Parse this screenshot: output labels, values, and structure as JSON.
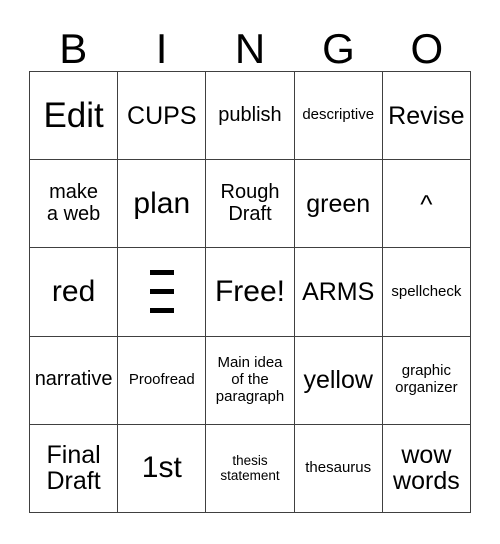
{
  "card": {
    "title": "BINGO",
    "header": {
      "letters": [
        "B",
        "I",
        "N",
        "G",
        "O"
      ]
    },
    "grid": {
      "rows": 5,
      "columns": 5,
      "border_color": "#404040",
      "background_color": "#ffffff",
      "text_color": "#000000"
    },
    "cells": [
      {
        "row": 1,
        "col": 1,
        "column_letter": "B",
        "text": "Edit",
        "size": "fs-xl",
        "glyph": "none"
      },
      {
        "row": 1,
        "col": 2,
        "column_letter": "I",
        "text": "CUPS",
        "size": "fs-md",
        "glyph": "none"
      },
      {
        "row": 1,
        "col": 3,
        "column_letter": "N",
        "text": "publish",
        "size": "fs-sm",
        "glyph": "none"
      },
      {
        "row": 1,
        "col": 4,
        "column_letter": "G",
        "text": "descriptive",
        "size": "fs-xs",
        "glyph": "none"
      },
      {
        "row": 1,
        "col": 5,
        "column_letter": "O",
        "text": "Revise",
        "size": "fs-md",
        "glyph": "none"
      },
      {
        "row": 2,
        "col": 1,
        "column_letter": "B",
        "text": "make\na web",
        "size": "fs-sm",
        "glyph": "none"
      },
      {
        "row": 2,
        "col": 2,
        "column_letter": "I",
        "text": "plan",
        "size": "fs-lg",
        "glyph": "none"
      },
      {
        "row": 2,
        "col": 3,
        "column_letter": "N",
        "text": "Rough\nDraft",
        "size": "fs-sm",
        "glyph": "none"
      },
      {
        "row": 2,
        "col": 4,
        "column_letter": "G",
        "text": "green",
        "size": "fs-md",
        "glyph": "none"
      },
      {
        "row": 2,
        "col": 5,
        "column_letter": "O",
        "text": "^",
        "size": "fs-sm",
        "glyph": "caret"
      },
      {
        "row": 3,
        "col": 1,
        "column_letter": "B",
        "text": "red",
        "size": "fs-lg",
        "glyph": "none"
      },
      {
        "row": 3,
        "col": 2,
        "column_letter": "I",
        "text": "",
        "size": "fs-md",
        "glyph": "triple-bar"
      },
      {
        "row": 3,
        "col": 3,
        "column_letter": "N",
        "text": "Free!",
        "size": "fs-lg",
        "glyph": "none"
      },
      {
        "row": 3,
        "col": 4,
        "column_letter": "G",
        "text": "ARMS",
        "size": "fs-md",
        "glyph": "none"
      },
      {
        "row": 3,
        "col": 5,
        "column_letter": "O",
        "text": "spellcheck",
        "size": "fs-xs",
        "glyph": "none"
      },
      {
        "row": 4,
        "col": 1,
        "column_letter": "B",
        "text": "narrative",
        "size": "fs-sm",
        "glyph": "none"
      },
      {
        "row": 4,
        "col": 2,
        "column_letter": "I",
        "text": "Proofread",
        "size": "fs-xs",
        "glyph": "none"
      },
      {
        "row": 4,
        "col": 3,
        "column_letter": "N",
        "text": "Main idea\nof the\nparagraph",
        "size": "fs-xs",
        "glyph": "none"
      },
      {
        "row": 4,
        "col": 4,
        "column_letter": "G",
        "text": "yellow",
        "size": "fs-md",
        "glyph": "none"
      },
      {
        "row": 4,
        "col": 5,
        "column_letter": "O",
        "text": "graphic\norganizer",
        "size": "fs-xs",
        "glyph": "none"
      },
      {
        "row": 5,
        "col": 1,
        "column_letter": "B",
        "text": "Final\nDraft",
        "size": "fs-md",
        "glyph": "none"
      },
      {
        "row": 5,
        "col": 2,
        "column_letter": "I",
        "text": "1st",
        "size": "fs-lg",
        "glyph": "none"
      },
      {
        "row": 5,
        "col": 3,
        "column_letter": "N",
        "text": "thesis\nstatement",
        "size": "fs-xxs",
        "glyph": "none"
      },
      {
        "row": 5,
        "col": 4,
        "column_letter": "G",
        "text": "thesaurus",
        "size": "fs-xs",
        "glyph": "none"
      },
      {
        "row": 5,
        "col": 5,
        "column_letter": "O",
        "text": "wow\nwords",
        "size": "fs-md",
        "glyph": "none"
      }
    ]
  }
}
